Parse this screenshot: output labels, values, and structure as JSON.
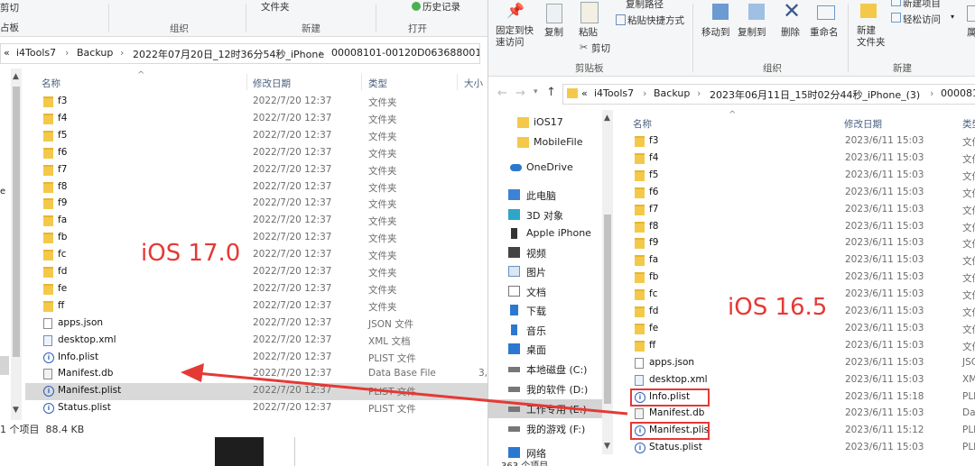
{
  "left": {
    "ribbon": {
      "cut": "剪切",
      "paste_partial": "占板",
      "folder": "文件夹",
      "history": "历史记录",
      "group_organize": "组织",
      "group_new": "新建",
      "group_open": "打开"
    },
    "address": {
      "back": "«",
      "crumbs": [
        "i4Tools7",
        "Backup",
        "2022年07月20日_12时36分54秒_iPhone",
        "00008101-00120D063688001E"
      ]
    },
    "columns": {
      "name": "名称",
      "date": "修改日期",
      "type": "类型",
      "size": "大小"
    },
    "rows": [
      {
        "name": "f3",
        "date": "2022/7/20 12:37",
        "type": "文件夹",
        "size": "",
        "icon": "folder"
      },
      {
        "name": "f4",
        "date": "2022/7/20 12:37",
        "type": "文件夹",
        "size": "",
        "icon": "folder"
      },
      {
        "name": "f5",
        "date": "2022/7/20 12:37",
        "type": "文件夹",
        "size": "",
        "icon": "folder"
      },
      {
        "name": "f6",
        "date": "2022/7/20 12:37",
        "type": "文件夹",
        "size": "",
        "icon": "folder"
      },
      {
        "name": "f7",
        "date": "2022/7/20 12:37",
        "type": "文件夹",
        "size": "",
        "icon": "folder"
      },
      {
        "name": "f8",
        "date": "2022/7/20 12:37",
        "type": "文件夹",
        "size": "",
        "icon": "folder"
      },
      {
        "name": "f9",
        "date": "2022/7/20 12:37",
        "type": "文件夹",
        "size": "",
        "icon": "folder"
      },
      {
        "name": "fa",
        "date": "2022/7/20 12:37",
        "type": "文件夹",
        "size": "",
        "icon": "folder"
      },
      {
        "name": "fb",
        "date": "2022/7/20 12:37",
        "type": "文件夹",
        "size": "",
        "icon": "folder"
      },
      {
        "name": "fc",
        "date": "2022/7/20 12:37",
        "type": "文件夹",
        "size": "",
        "icon": "folder"
      },
      {
        "name": "fd",
        "date": "2022/7/20 12:37",
        "type": "文件夹",
        "size": "",
        "icon": "folder"
      },
      {
        "name": "fe",
        "date": "2022/7/20 12:37",
        "type": "文件夹",
        "size": "",
        "icon": "folder"
      },
      {
        "name": "ff",
        "date": "2022/7/20 12:37",
        "type": "文件夹",
        "size": "",
        "icon": "folder"
      },
      {
        "name": "apps.json",
        "date": "2022/7/20 12:37",
        "type": "JSON 文件",
        "size": "",
        "icon": "file"
      },
      {
        "name": "desktop.xml",
        "date": "2022/7/20 12:37",
        "type": "XML 文档",
        "size": "",
        "icon": "xml"
      },
      {
        "name": "Info.plist",
        "date": "2022/7/20 12:37",
        "type": "PLIST 文件",
        "size": "",
        "icon": "plist"
      },
      {
        "name": "Manifest.db",
        "date": "2022/7/20 12:37",
        "type": "Data Base File",
        "size": "3,",
        "icon": "db"
      },
      {
        "name": "Manifest.plist",
        "date": "2022/7/20 12:37",
        "type": "PLIST 文件",
        "size": "",
        "icon": "plist",
        "selected": true
      },
      {
        "name": "Status.plist",
        "date": "2022/7/20 12:37",
        "type": "PLIST 文件",
        "size": "",
        "icon": "plist"
      }
    ],
    "status": "1 个项目  88.4 KB",
    "annotation": "iOS 17.0"
  },
  "right": {
    "ribbon": {
      "pin": "固定到快\n速访问",
      "copy": "复制",
      "paste": "粘贴",
      "copy_path": "复制路径",
      "paste_shortcut": "粘贴快捷方式",
      "cut": "剪切",
      "move_to": "移动到",
      "copy_to": "复制到",
      "delete": "删除",
      "rename": "重命名",
      "new_folder": "新建\n文件夹",
      "new_item": "新建项目",
      "easy_access": "轻松访问",
      "props_partial": "属",
      "group_clipboard": "剪贴板",
      "group_organize": "组织",
      "group_new": "新建"
    },
    "address": {
      "back": "«",
      "crumbs": [
        "i4Tools7",
        "Backup",
        "2023年06月11日_15时02分44秒_iPhone_(3)",
        "000081C"
      ]
    },
    "nav": [
      {
        "label": "iOS17",
        "icon": "folder"
      },
      {
        "label": "MobileFile",
        "icon": "folder"
      },
      {
        "label": "OneDrive",
        "icon": "cloud"
      },
      {
        "label": "此电脑",
        "icon": "pc"
      },
      {
        "label": "3D 对象",
        "icon": "cube"
      },
      {
        "label": "Apple iPhone",
        "icon": "phone"
      },
      {
        "label": "视频",
        "icon": "video"
      },
      {
        "label": "图片",
        "icon": "picture"
      },
      {
        "label": "文档",
        "icon": "doc"
      },
      {
        "label": "下载",
        "icon": "download"
      },
      {
        "label": "音乐",
        "icon": "music"
      },
      {
        "label": "桌面",
        "icon": "desktop"
      },
      {
        "label": "本地磁盘 (C:)",
        "icon": "drive"
      },
      {
        "label": "我的软件 (D:)",
        "icon": "drive"
      },
      {
        "label": "工作专用 (E:)",
        "icon": "drive",
        "selected": true
      },
      {
        "label": "我的游戏 (F:)",
        "icon": "drive"
      },
      {
        "label": "网络",
        "icon": "network"
      }
    ],
    "nav_footer": "363 个项目",
    "columns": {
      "name": "名称",
      "date": "修改日期",
      "type": "类型"
    },
    "rows": [
      {
        "name": "f3",
        "date": "2023/6/11 15:03",
        "type": "文件",
        "icon": "folder"
      },
      {
        "name": "f4",
        "date": "2023/6/11 15:03",
        "type": "文件",
        "icon": "folder"
      },
      {
        "name": "f5",
        "date": "2023/6/11 15:03",
        "type": "文件",
        "icon": "folder"
      },
      {
        "name": "f6",
        "date": "2023/6/11 15:03",
        "type": "文件",
        "icon": "folder"
      },
      {
        "name": "f7",
        "date": "2023/6/11 15:03",
        "type": "文件",
        "icon": "folder"
      },
      {
        "name": "f8",
        "date": "2023/6/11 15:03",
        "type": "文件",
        "icon": "folder"
      },
      {
        "name": "f9",
        "date": "2023/6/11 15:03",
        "type": "文件",
        "icon": "folder"
      },
      {
        "name": "fa",
        "date": "2023/6/11 15:03",
        "type": "文件",
        "icon": "folder"
      },
      {
        "name": "fb",
        "date": "2023/6/11 15:03",
        "type": "文件",
        "icon": "folder"
      },
      {
        "name": "fc",
        "date": "2023/6/11 15:03",
        "type": "文件",
        "icon": "folder"
      },
      {
        "name": "fd",
        "date": "2023/6/11 15:03",
        "type": "文件",
        "icon": "folder"
      },
      {
        "name": "fe",
        "date": "2023/6/11 15:03",
        "type": "文件",
        "icon": "folder"
      },
      {
        "name": "ff",
        "date": "2023/6/11 15:03",
        "type": "文件",
        "icon": "folder"
      },
      {
        "name": "apps.json",
        "date": "2023/6/11 15:03",
        "type": "JSC",
        "icon": "file"
      },
      {
        "name": "desktop.xml",
        "date": "2023/6/11 15:03",
        "type": "XM",
        "icon": "xml"
      },
      {
        "name": "Info.plist",
        "date": "2023/6/11 15:18",
        "type": "PLI",
        "icon": "plist",
        "boxed": true
      },
      {
        "name": "Manifest.db",
        "date": "2023/6/11 15:03",
        "type": "Da",
        "icon": "db"
      },
      {
        "name": "Manifest.plis",
        "date": "2023/6/11 15:12",
        "type": "PLI",
        "icon": "plist",
        "boxed": true
      },
      {
        "name": "Status.plist",
        "date": "2023/6/11 15:03",
        "type": "PLI",
        "icon": "plist"
      }
    ],
    "annotation": "iOS 16.5"
  },
  "colors": {
    "annotation_red": "#e53935",
    "selection_gray": "#d9d9d9",
    "folder_yellow": "#f4c94a"
  }
}
